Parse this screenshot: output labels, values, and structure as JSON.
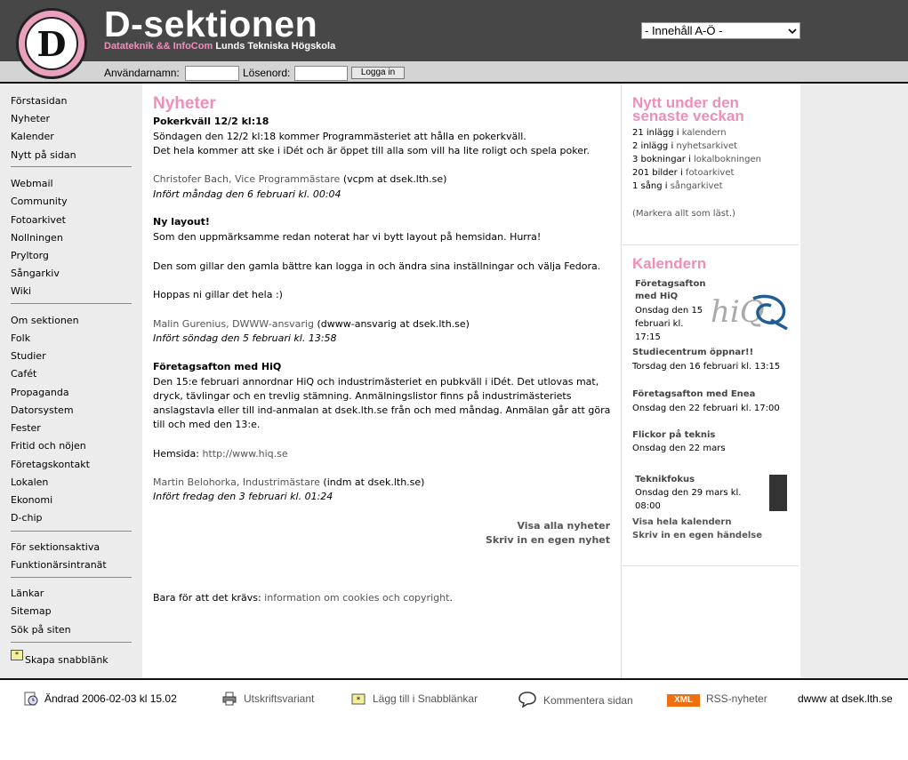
{
  "header": {
    "logo_text": "D",
    "logo_ring_text": "Datateknik Lunds Tekniska Högskola",
    "title": "D-sektionen",
    "subtitle_pink": "Datateknik && InfoCom",
    "subtitle_white": "Lunds Tekniska Högskola",
    "az_select": "- Innehåll A-Ö -"
  },
  "login": {
    "user_label": "Användarnamn:",
    "pass_label": "Lösenord:",
    "button": "Logga in"
  },
  "sidebar": {
    "group1": [
      "Förstasidan",
      "Nyheter",
      "Kalender",
      "Nytt på sidan"
    ],
    "group2": [
      "Webmail",
      "Community",
      "Fotoarkivet",
      "Nollningen",
      "Pryltorg",
      "Sångarkiv",
      "Wiki"
    ],
    "group3": [
      "Om sektionen",
      "Folk",
      "Studier",
      "Cafét",
      "Propaganda",
      "Datorsystem",
      "Fester",
      "Fritid och nöjen",
      "Företagskontakt",
      "Lokalen",
      "Ekonomi",
      "D-chip"
    ],
    "group4": [
      "För sektionsaktiva",
      "Funktionärsintranät"
    ],
    "group5": [
      "Länkar",
      "Sitemap",
      "Sök på siten"
    ],
    "snabb": "Skapa snabblänk"
  },
  "news": {
    "heading": "Nyheter",
    "items": [
      {
        "title": "Pokerkväll 12/2 kl:18",
        "lines": [
          "Söndagen den 12/2 kl:18 kommer Programmästeriet att hålla en pokerkväll.",
          "Det hela kommer att ske i iDét och är öppet till alla som vill ha lite roligt och spela poker."
        ],
        "author": "Christofer Bach, Vice Programmästare",
        "email": " (vcpm at dsek.lth.se)",
        "date": "Infört måndag den 6 februari kl. 00:04"
      },
      {
        "title": "Ny layout!",
        "lines": [
          "Som den uppmärksamme redan noterat har vi bytt layout på hemsidan. Hurra!",
          "Den som gillar den gamla bättre kan logga in och ändra sina inställningar och välja Fedora.",
          "Hoppas ni gillar det hela :)"
        ],
        "author": "Malin Gurenius, DWWW-ansvarig",
        "email": " (dwww-ansvarig at dsek.lth.se)",
        "date": "Infört söndag den 5 februari kl. 13:58"
      },
      {
        "title": "Företagsafton med HiQ",
        "lines": [
          "Den 15:e februari annordnar HiQ och industrimästeriet en pubkväll i iDét. Det utlovas mat,",
          "dryck, tävlingar och en trevlig stämning. Anmälningslistor finns på industrimästeriets",
          "anslagstavla eller till ind-anmalan at dsek.lth.se från och med måndag. Anmälan går att göra",
          "till och med den 13:e."
        ],
        "home_label": "Hemsida: ",
        "home_url": "http://www.hiq.se",
        "author": "Martin Belohorka, Industrimästare",
        "email": " (indm at dsek.lth.se)",
        "date": "Infört fredag den 3 februari kl. 01:24"
      }
    ],
    "show_all": "Visa alla nyheter",
    "write_own": "Skriv in en egen nyhet",
    "cookies_prefix": "Bara för att det krävs: ",
    "cookies_link": "information om cookies och copyright",
    "cookies_suffix": "."
  },
  "recent": {
    "heading_l1": "Nytt under den",
    "heading_l2": "senaste veckan",
    "items": [
      {
        "count": "21 inlägg i ",
        "link": "kalendern"
      },
      {
        "count": "2 inlägg i ",
        "link": "nyhetsarkivet"
      },
      {
        "count": "3 bokningar i ",
        "link": "lokalbokningen"
      },
      {
        "count": "201 bilder i ",
        "link": "fotoarkivet"
      },
      {
        "count": "1 sång i ",
        "link": "sångarkivet"
      }
    ],
    "mark_read": "(Markera allt som läst.)"
  },
  "calendar": {
    "heading": "Kalendern",
    "events": [
      {
        "title_l1": "Företagsafton",
        "title_l2": "med HiQ",
        "date_l1": "Onsdag den 15",
        "date_l2": "februari kl.",
        "date_l3": "17:15"
      },
      {
        "title": "Studiecentrum öppnar!!",
        "date": "Torsdag den 16 februari kl. 13:15"
      },
      {
        "title": "Företagsafton med Enea",
        "date": "Onsdag den 22 februari kl. 17:00"
      },
      {
        "title": "Flickor på teknis",
        "date": "Onsdag den 22 mars"
      },
      {
        "title": "Teknikfokus",
        "date_l1": "Onsdag den 29 mars kl.",
        "date_l2": "08:00"
      }
    ],
    "show_all": "Visa hela kalendern",
    "write_own": "Skriv in en egen händelse",
    "hiq_logo": "hiQ"
  },
  "footer": {
    "changed": "Ändrad 2006-02-03 kl 15.02",
    "print": "Utskriftsvariant",
    "add_snabb": "Lägg till i Snabblänkar",
    "comment": "Kommentera sidan",
    "xml": "XML",
    "rss": "RSS-nyheter",
    "contact": "dwww at dsek.lth.se"
  }
}
